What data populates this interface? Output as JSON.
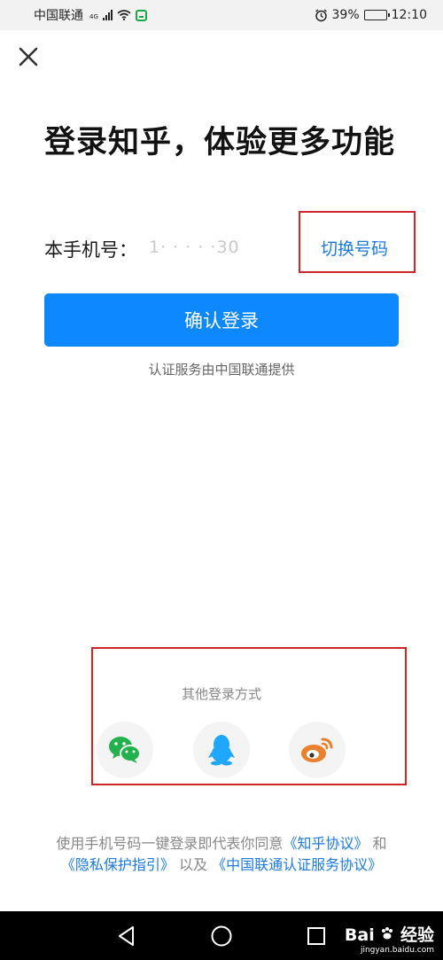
{
  "status_bar": {
    "carrier": "中国联通",
    "network_type": "4G",
    "battery": "39%",
    "battery_level": 0.39,
    "time": "12:10",
    "icons": [
      "signal-icon",
      "wifi-icon",
      "app-notification-icon",
      "alarm-icon",
      "battery-icon"
    ]
  },
  "header": {
    "close_icon": "close-icon",
    "title": "登录知乎，体验更多功能"
  },
  "phone": {
    "label": "本手机号：",
    "number_masked": "1·   ·  ·   ·  ·30",
    "switch_label": "切换号码"
  },
  "login": {
    "confirm_label": "确认登录",
    "auth_note": "认证服务由中国联通提供"
  },
  "other_login": {
    "title": "其他登录方式",
    "methods": [
      {
        "icon": "wechat-icon",
        "color": "#22b14c"
      },
      {
        "icon": "qq-icon",
        "color": "#1ea7fd"
      },
      {
        "icon": "weibo-icon",
        "color": "#e9812e"
      }
    ]
  },
  "agreement": {
    "prefix": "使用手机号码一键登录即代表你同意",
    "link1": "《知乎协议》",
    "and": "和",
    "link2": "《隐私保护指引》",
    "also": "以及",
    "link3": "《中国联通认证服务协议》"
  },
  "nav": {
    "icons": [
      "back-icon",
      "home-icon",
      "recents-icon"
    ]
  },
  "watermark": {
    "brand": "Bai",
    "suffix": "经验",
    "url": "jingyan.baidu.com"
  },
  "colors": {
    "primary": "#0e88ff",
    "link": "#1c7ae0",
    "highlight_box": "#d0262b"
  }
}
